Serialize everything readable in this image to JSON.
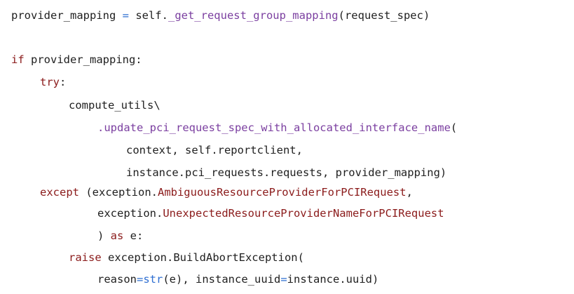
{
  "colors": {
    "background": "#ffffff",
    "text": "#1f1f1f",
    "keyword": "#8b1b1b",
    "function": "#7b3fa0",
    "builtin": "#2f6fd2"
  },
  "code": {
    "line1": {
      "lhs": "provider_mapping",
      "assign": " = ",
      "obj": "self.",
      "call": "_get_request_group_mapping",
      "args": "(request_spec)"
    },
    "line2": {
      "kw": "if",
      "rest": " provider_mapping:"
    },
    "line3": {
      "kw": "try",
      "rest": ":"
    },
    "line4": {
      "text": "compute_utils\\"
    },
    "line5": {
      "call": ".update_pci_request_spec_with_allocated_interface_name",
      "paren": "("
    },
    "line6": {
      "text": "context, self.reportclient,"
    },
    "line7": {
      "text": "instance.pci_requests.requests, provider_mapping)"
    },
    "line8": {
      "kw": "except",
      "pre": " (exception.",
      "cls": "AmbiguousResourceProviderForPCIRequest",
      "post": ","
    },
    "line9": {
      "pre": "exception.",
      "cls": "UnexpectedResourceProviderNameForPCIRequest"
    },
    "line10": {
      "pre": ") ",
      "kw": "as",
      "post": " e:"
    },
    "line11": {
      "kw": "raise",
      "pre": " exception.",
      "call": "BuildAbortException",
      "post": "("
    },
    "line12": {
      "pre": "reason",
      "eq1": "=",
      "builtin": "str",
      "mid": "(e), instance_uuid",
      "eq2": "=",
      "post": "instance.uuid)"
    }
  }
}
